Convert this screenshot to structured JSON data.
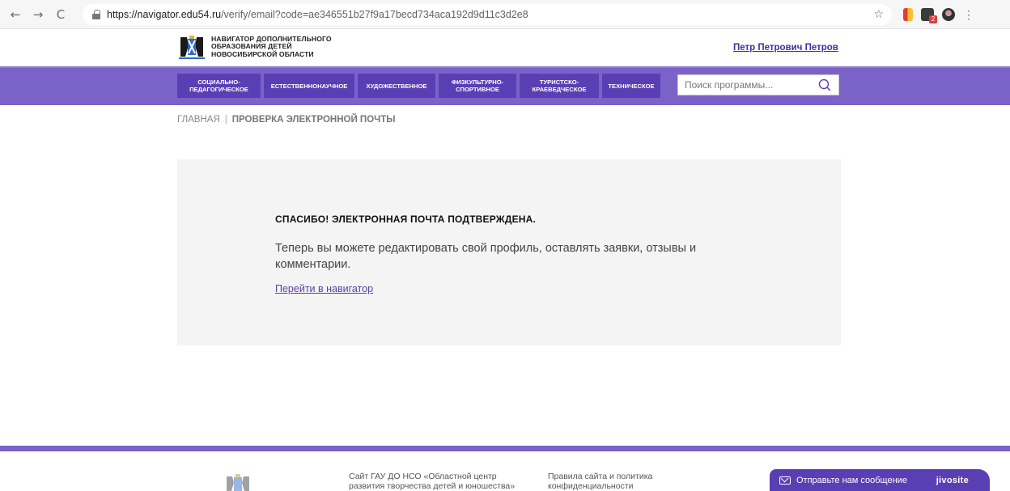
{
  "browser": {
    "url_host": "https://navigator.edu54.ru",
    "url_path": "/verify/email?code=ae346551b27f9a17becd734aca192d9d11c3d2e8",
    "back_icon": "←",
    "forward_icon": "→",
    "reload_icon": "C",
    "star_icon": "☆",
    "menu_icon": "⋮"
  },
  "header": {
    "logo_line1": "НАВИГАТОР ДОПОЛНИТЕЛЬНОГО",
    "logo_line2": "ОБРАЗОВАНИЯ ДЕТЕЙ",
    "logo_line3": "НОВОСИБИРСКОЙ ОБЛАСТИ",
    "user_name": "Петр Петрович Петров"
  },
  "nav": {
    "items": [
      {
        "line1": "СОЦИАЛЬНО-",
        "line2": "ПЕДАГОГИЧЕСКОЕ"
      },
      {
        "line1": "ЕСТЕСТВЕННОНАУЧНОЕ",
        "line2": ""
      },
      {
        "line1": "ХУДОЖЕСТВЕННОЕ",
        "line2": ""
      },
      {
        "line1": "ФИЗКУЛЬТУРНО-",
        "line2": "СПОРТИВНОЕ"
      },
      {
        "line1": "ТУРИСТСКО-",
        "line2": "КРАЕВЕДЧЕСКОЕ"
      },
      {
        "line1": "ТЕХНИЧЕСКОЕ",
        "line2": ""
      }
    ],
    "search_placeholder": "Поиск программы..."
  },
  "breadcrumb": {
    "home": "ГЛАВНАЯ",
    "separator": "|",
    "current": "ПРОВЕРКА ЭЛЕКТРОННОЙ ПОЧТЫ"
  },
  "main": {
    "title": "СПАСИБО! ЭЛЕКТРОННАЯ ПОЧТА ПОДТВЕРЖДЕНА.",
    "text": "Теперь вы можете редактировать свой профиль, оставлять заявки, отзывы и комментарии.",
    "link": "Перейти в навигатор"
  },
  "footer": {
    "col1_line1": "Сайт ГАУ ДО НСО «Областной центр",
    "col1_line2": "развития творчества детей и юношества»",
    "col2_line1": "Правила сайта и политика",
    "col2_line2": "конфиденциальности"
  },
  "chat": {
    "label": "Отправьте нам сообщение",
    "brand": "jivosite"
  },
  "colors": {
    "nav_bg": "#7a62c8",
    "nav_item_bg": "#5a3fb4",
    "link": "#5b3ea8",
    "card_bg": "#f4f4f4"
  }
}
